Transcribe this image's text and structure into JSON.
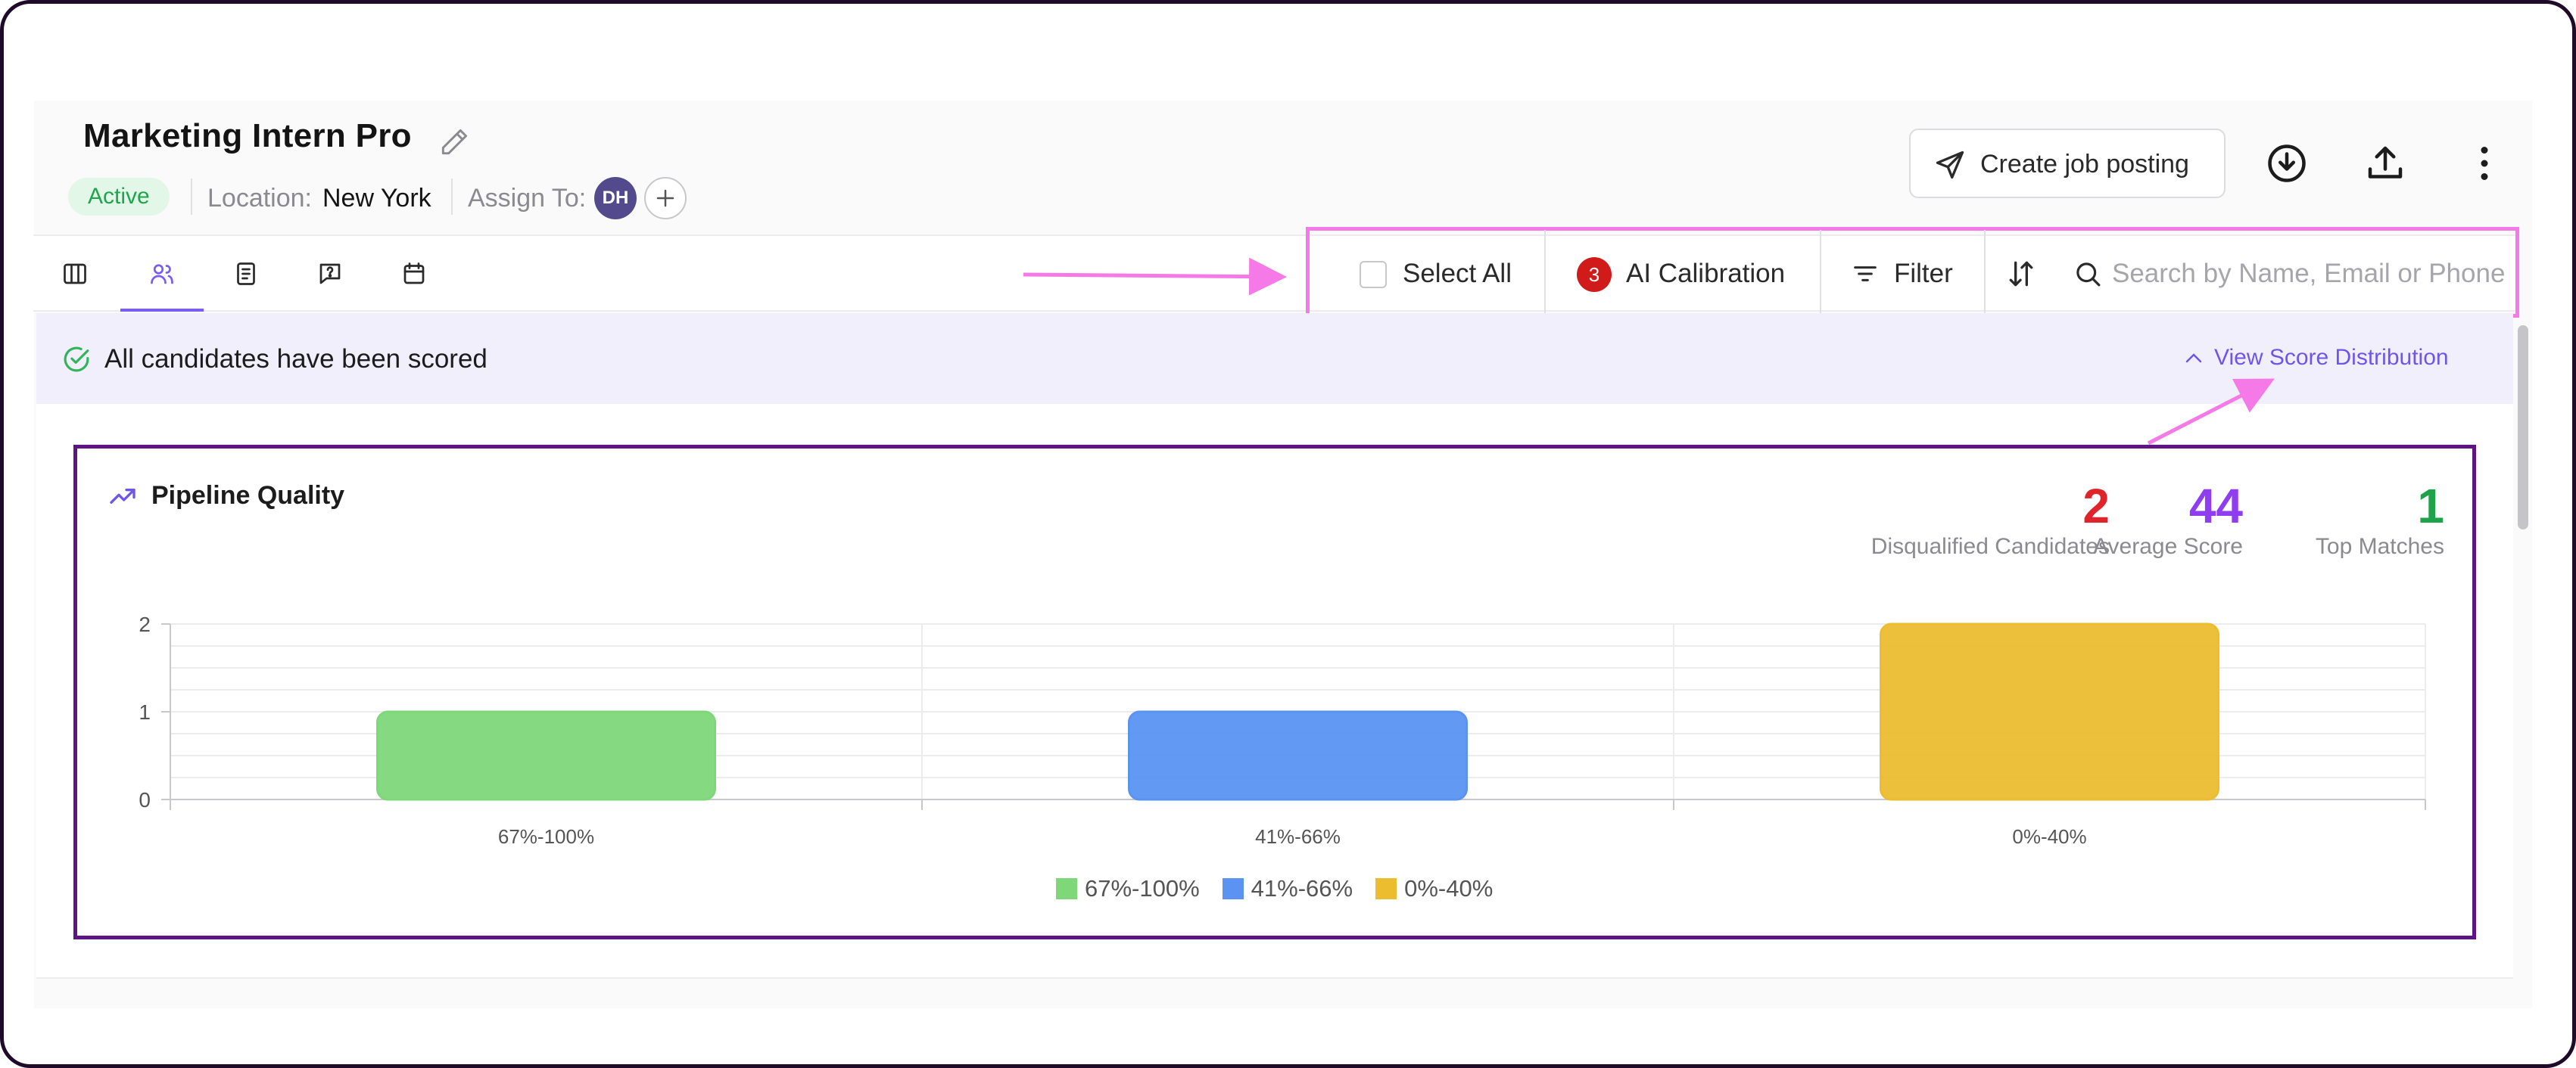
{
  "job": {
    "title": "Marketing Intern Pro",
    "status": "Active",
    "location_label": "Location:",
    "location_value": "New York",
    "assign_label": "Assign To:",
    "assignee_initials": "DH"
  },
  "header_actions": {
    "create_job_posting": "Create job posting",
    "icons": [
      "download-icon",
      "upload-icon",
      "more-vertical-icon"
    ]
  },
  "tabs": [
    {
      "icon": "columns-icon",
      "active": false
    },
    {
      "icon": "candidates-icon",
      "active": true
    },
    {
      "icon": "document-icon",
      "active": false
    },
    {
      "icon": "question-chat-icon",
      "active": false
    },
    {
      "icon": "calendar-icon",
      "active": false
    }
  ],
  "toolbar": {
    "select_all": "Select All",
    "ai_calibration_count": "3",
    "ai_calibration": "AI Calibration",
    "filter": "Filter",
    "search_placeholder": "Search by Name, Email or Phone"
  },
  "banner": {
    "message": "All candidates have been scored",
    "view_distribution": "View Score Distribution"
  },
  "pipeline": {
    "title": "Pipeline Quality",
    "stats": [
      {
        "value": "2",
        "label": "Disqualified Candidates",
        "color": "#e0242b"
      },
      {
        "value": "44",
        "label": "Average Score",
        "color": "#8e3ef0"
      },
      {
        "value": "1",
        "label": "Top Matches",
        "color": "#1fa34a"
      }
    ]
  },
  "chart_data": {
    "type": "bar",
    "categories": [
      "67%-100%",
      "41%-66%",
      "0%-40%"
    ],
    "values": [
      1,
      1,
      2
    ],
    "colors": [
      "#7ed87a",
      "#5a93f2",
      "#ebbd2f"
    ],
    "legend": [
      "67%-100%",
      "41%-66%",
      "0%-40%"
    ],
    "legend_placement": "bottom",
    "yticks": [
      "0",
      "1",
      "2"
    ],
    "ylim": [
      0,
      2
    ],
    "grid": true,
    "title": "",
    "xlabel": "",
    "ylabel": ""
  },
  "colors": {
    "accent": "#7b5cf0",
    "annotation_pink": "#f57ae8",
    "card_border": "#5e1483"
  }
}
